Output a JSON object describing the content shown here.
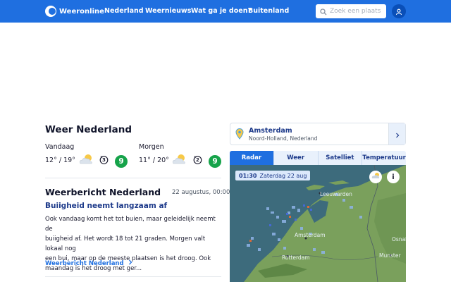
{
  "header": {
    "logo_text": "Weeronline",
    "nav": [
      "Nederland",
      "Weernieuws",
      "Wat ga je doen?",
      "Buitenland"
    ],
    "search_placeholder": "Zoek een plaats"
  },
  "weather": {
    "title": "Weer Nederland",
    "today": {
      "label": "Vandaag",
      "temps": "12° / 19°",
      "score": "9",
      "wind_force": "3"
    },
    "tomorrow": {
      "label": "Morgen",
      "temps": "11° / 20°",
      "score": "9",
      "wind_force": "2"
    }
  },
  "report": {
    "title": "Weerbericht Nederland",
    "date": "22 augustus, 00:00",
    "headline": "Buiigheid neemt langzaam af",
    "lines": [
      "Ook vandaag komt het tot buien, maar geleidelijk neemt de",
      "buiigheid af. Het wordt 18 tot 21 graden. Morgen valt lokaal nog",
      "een bui, maar op de meeste plaatsen is het droog. Ook",
      "maandag is het droog met ger..."
    ],
    "link": "Weerbericht Nederland"
  },
  "location": {
    "name": "Amsterdam",
    "region": "Noord-Holland, Nederland"
  },
  "map": {
    "tabs": [
      "Radar",
      "Weer",
      "Satelliet",
      "Temperatuur"
    ],
    "active_tab": 0,
    "time": "01:30",
    "date": "Zaterdag 22 aug",
    "info_label": "i",
    "cities": [
      "Leeuwarden",
      "Amsterdam",
      "Rotterdam",
      "Osnabr",
      "Munster"
    ]
  },
  "colors": {
    "brand": "#1f6fe0",
    "score": "#16a34a",
    "sea": "#3d6b7c",
    "land": "#7aa05c"
  }
}
